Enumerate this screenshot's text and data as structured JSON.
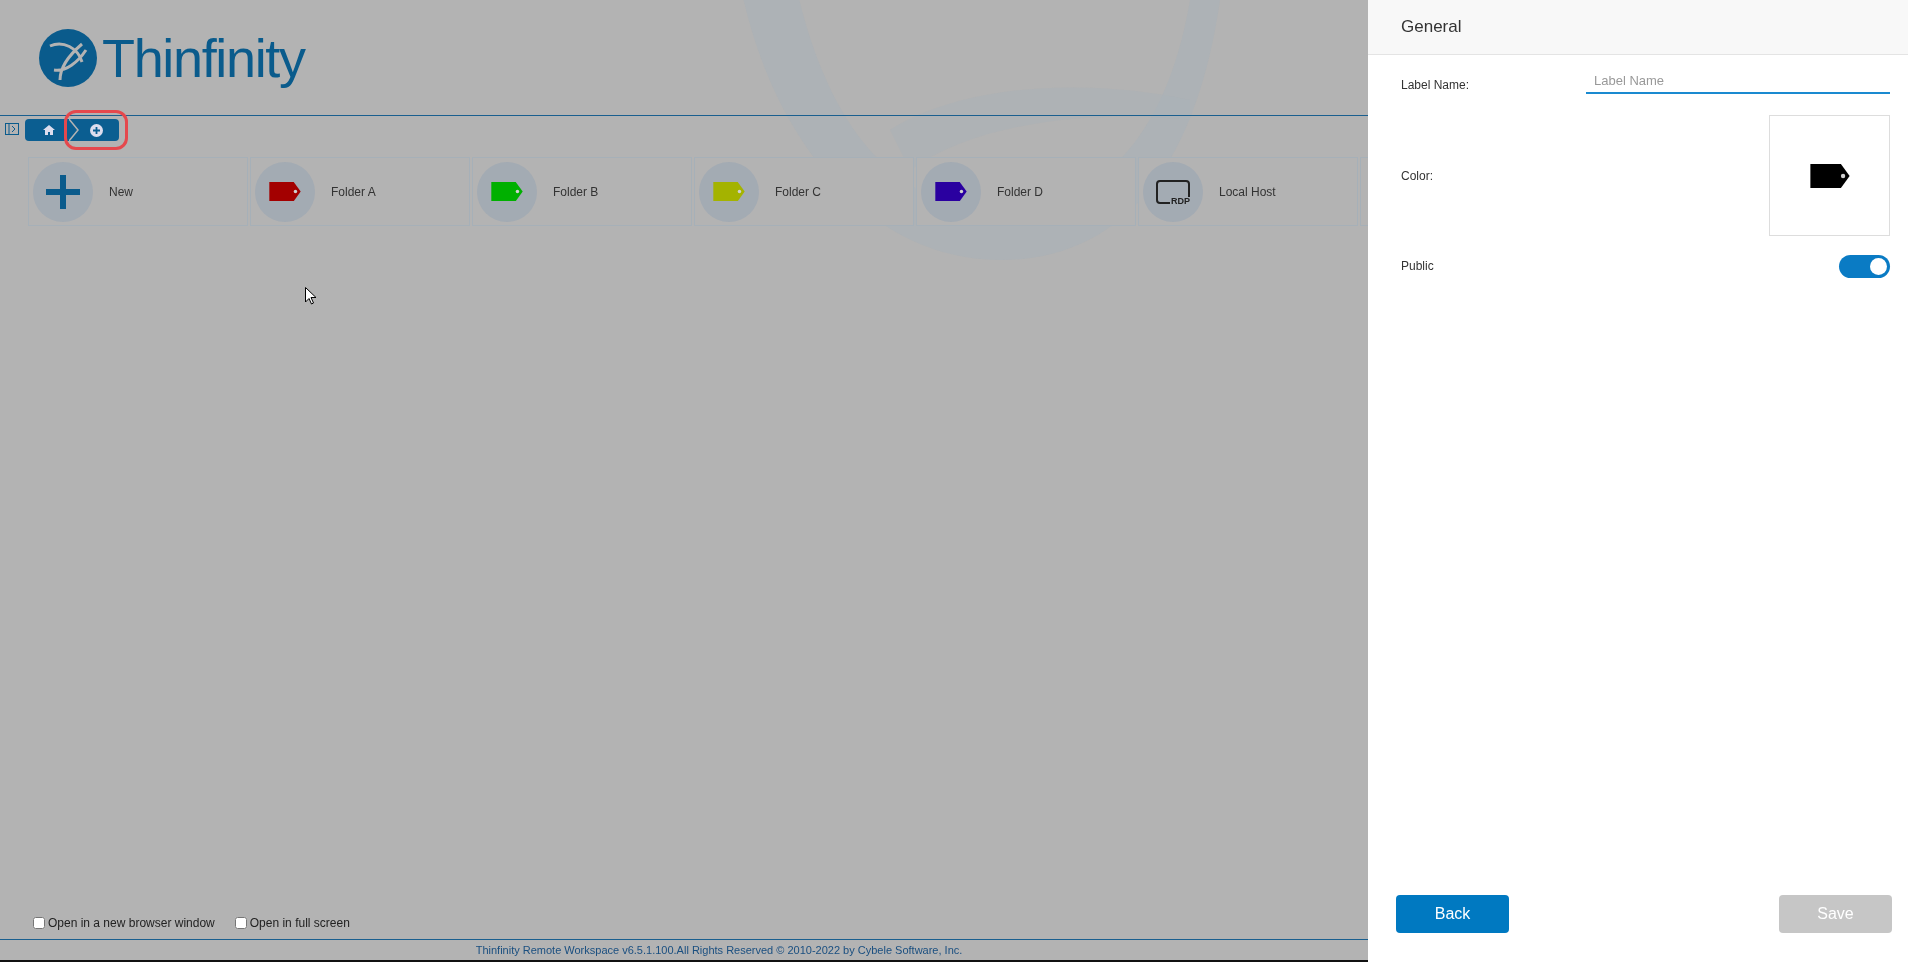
{
  "logo": {
    "text": "Thinfinity"
  },
  "breadcrumb": [
    {
      "kind": "home",
      "selected": false
    },
    {
      "kind": "add",
      "selected": true
    }
  ],
  "tiles": [
    {
      "kind": "new",
      "label": "New"
    },
    {
      "kind": "tag",
      "label": "Folder A",
      "color": "#a30000"
    },
    {
      "kind": "tag",
      "label": "Folder B",
      "color": "#00b000"
    },
    {
      "kind": "tag",
      "label": "Folder C",
      "color": "#a4b300"
    },
    {
      "kind": "tag",
      "label": "Folder D",
      "color": "#2a00a0"
    },
    {
      "kind": "rdp",
      "label": "Local Host",
      "icon_text": "RDP"
    },
    {
      "kind": "cut"
    }
  ],
  "options": [
    {
      "label": "Open in a new browser window",
      "checked": false
    },
    {
      "label": "Open in full screen",
      "checked": false
    }
  ],
  "footer": "Thinfinity Remote Workspace v6.5.1.100.All Rights Reserved © 2010-2022 by Cybele Software, Inc.",
  "panel": {
    "title": "General",
    "label_name": {
      "label": "Label Name:",
      "placeholder": "Label Name"
    },
    "color": {
      "label": "Color:",
      "color": "#000000"
    },
    "public": {
      "label": "Public",
      "on": true
    },
    "back": {
      "label": "Back"
    },
    "save": {
      "label": "Save",
      "disabled": true
    }
  }
}
